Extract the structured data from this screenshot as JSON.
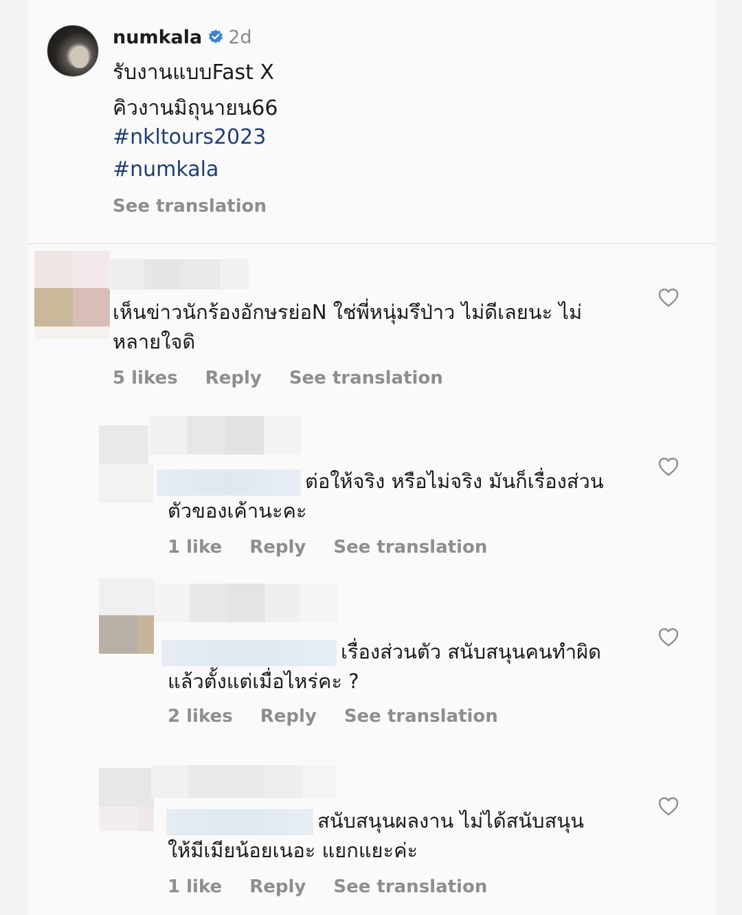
{
  "post": {
    "username": "numkala",
    "time": "2d",
    "caption_lines": [
      "รับงานแบบFast X",
      "คิวงานมิถุนายน66"
    ],
    "hashtags": [
      "#nkltours2023",
      "#numkala"
    ],
    "see_translation": "See translation"
  },
  "comments": [
    {
      "line1": "เห็นข่าวนักร้องอักษรย่อN ใช่พี่หนุ่มรึป่าว ไม่ดีเลยนะ ไม่",
      "line2": "หลายใจดิ",
      "likes": "5 likes",
      "reply": "Reply",
      "see_translation": "See translation"
    },
    {
      "line1": "ต่อให้จริง หรือไม่จริง มันก็เรื่องส่วน",
      "line2": "ตัวของเค้านะคะ",
      "likes": "1 like",
      "reply": "Reply",
      "see_translation": "See translation"
    },
    {
      "line1": "เรื่องส่วนตัว สนับสนุนคนทำผิด",
      "line2": "แล้วตั้งแต่เมื่อไหร่คะ ?",
      "likes": "2 likes",
      "reply": "Reply",
      "see_translation": "See translation"
    },
    {
      "line1": "สนับสนุนผลงาน ไม่ได้สนับสนุน",
      "line2": "ให้มีเมียน้อยเนอะ แยกแยะค่ะ",
      "likes": "1 like",
      "reply": "Reply",
      "see_translation": "See translation"
    }
  ],
  "icons": {
    "verified": "verified-badge-icon",
    "like": "heart-outline-icon"
  },
  "colors": {
    "hashtag": "#1f3f70",
    "secondary_text": "#8e8e8e",
    "verified": "#3b82d6"
  }
}
